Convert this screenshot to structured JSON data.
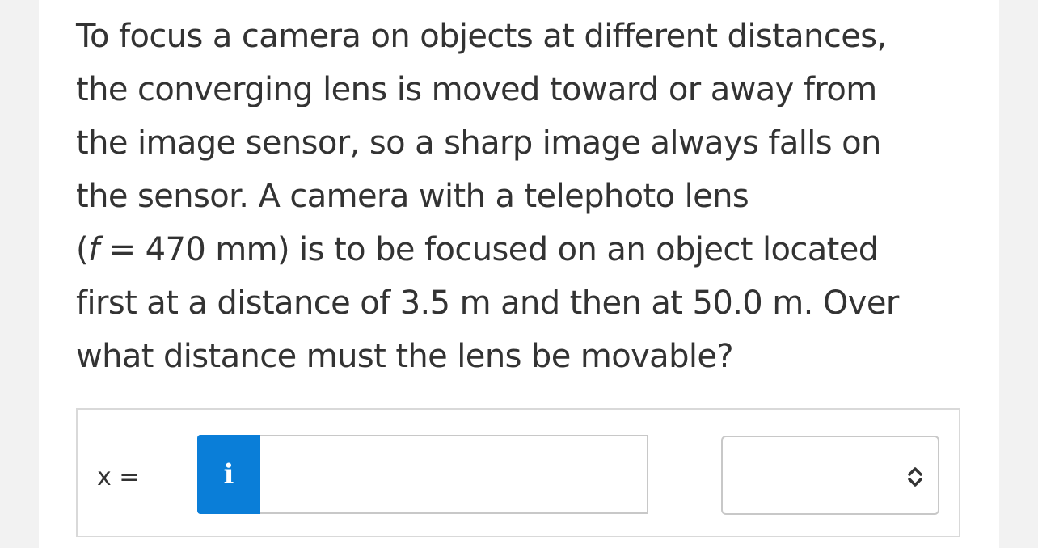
{
  "question": {
    "line1": "To focus a camera on objects at different distances,",
    "line2": "the converging lens is moved toward or away from",
    "line3": "the image sensor, so a sharp image always falls on",
    "line4": "the sensor. A camera with a telephoto lens",
    "line5_open": "(",
    "line5_var": "f",
    "line5_rest": " = 470 mm) is to be focused on an object located",
    "line6": "first at a distance of 3.5 m and then at 50.0 m. Over",
    "line7": "what distance must the lens be movable?"
  },
  "answer": {
    "variable": "x",
    "equals": " =",
    "info_glyph": "i",
    "input_value": "",
    "unit_selected": "",
    "icons": {
      "info": "info-icon",
      "select_chevron": "up-down-chevron-icon"
    }
  },
  "colors": {
    "accent": "#0a7ed8",
    "text": "#333333",
    "border": "#c8c8c8"
  }
}
